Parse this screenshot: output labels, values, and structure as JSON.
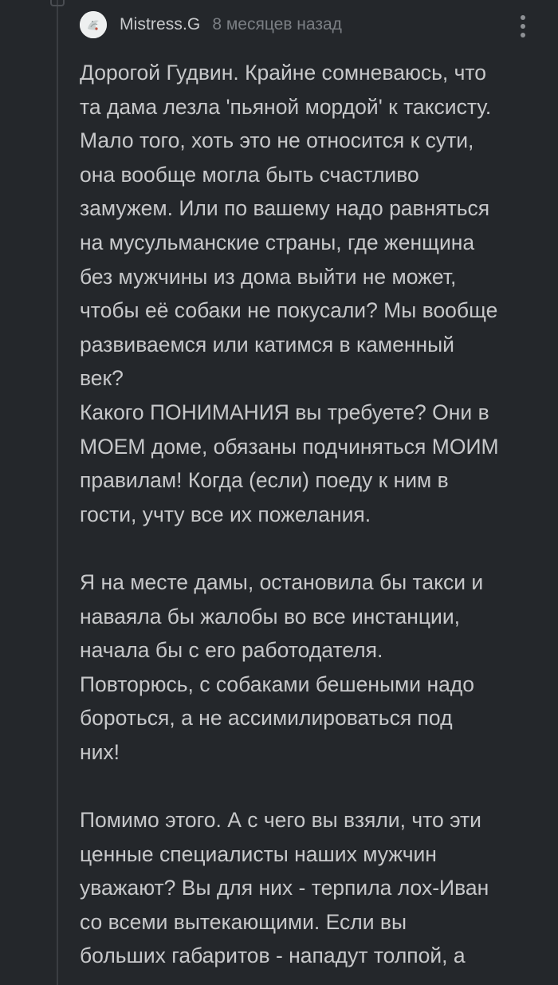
{
  "comment": {
    "author": "Mistress.G",
    "time": "8 месяцев назад",
    "avatar_icon": "avatar-icon",
    "more_icon": "more-vertical-icon",
    "paragraphs": [
      [
        "Дорогой Гудвин. Крайне сомневаюсь, что",
        "та дама лезла 'пьяной мордой' к таксисту.",
        "Мало того, хоть это не относится к сути,",
        "она вообще могла быть счастливо",
        "замужем. Или по вашему надо равняться",
        "на мусульманские страны, где женщина",
        "без мужчины из дома выйти не может,",
        "чтобы её собаки не покусали? Мы вообще",
        "развиваемся или катимся в каменный",
        "век?",
        "Какого ПОНИМАНИЯ вы требуете? Они в",
        "МОЕМ доме, обязаны подчиняться МОИМ",
        "правилам! Когда (если) поеду к ним в",
        "гости, учту все их пожелания."
      ],
      [
        "Я на месте дамы, остановила бы такси и",
        "наваяла бы жалобы во все инстанции,",
        "начала бы с его работодателя.",
        "Повторюсь, с собаками бешеными надо",
        "бороться, а не ассимилироваться под",
        "них!"
      ],
      [
        "Помимо этого. А с чего вы взяли, что эти",
        "ценные специалисты наших мужчин",
        "уважают? Вы для них - терпила лох-Иван",
        "со всеми вытекающими. Если вы",
        "больших габаритов - нападут толпой, а"
      ]
    ]
  },
  "colors": {
    "background": "#24272b",
    "text": "#c7c8ca",
    "muted": "#7b7f84",
    "thread_line": "#3a3d42"
  }
}
